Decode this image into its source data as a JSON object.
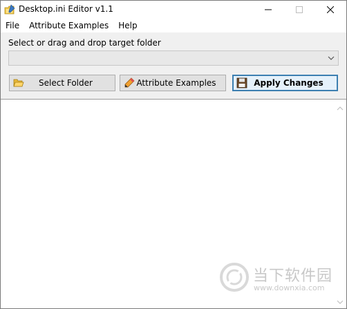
{
  "window": {
    "title": "Desktop.ini Editor v1.1",
    "controls": {
      "minimize": "minimize",
      "maximize": "maximize",
      "close": "close"
    }
  },
  "menu": {
    "items": [
      {
        "label": "File"
      },
      {
        "label": "Attribute Examples"
      },
      {
        "label": "Help"
      }
    ]
  },
  "folder": {
    "label": "Select or drag and drop target folder",
    "selected_value": ""
  },
  "buttons": {
    "select_folder": {
      "label": "Select Folder",
      "icon": "open-folder-icon"
    },
    "attribute_examples": {
      "label": "Attribute Examples",
      "icon": "pencil-icon"
    },
    "apply_changes": {
      "label": "Apply Changes",
      "icon": "floppy-disk-icon"
    }
  },
  "editor": {
    "content": ""
  },
  "watermark": {
    "name": "当下软件园",
    "url": "www.downxia.com"
  },
  "colors": {
    "accent_border": "#3c7fb1",
    "button_face": "#e1e1e1",
    "background": "#f0f0f0"
  }
}
